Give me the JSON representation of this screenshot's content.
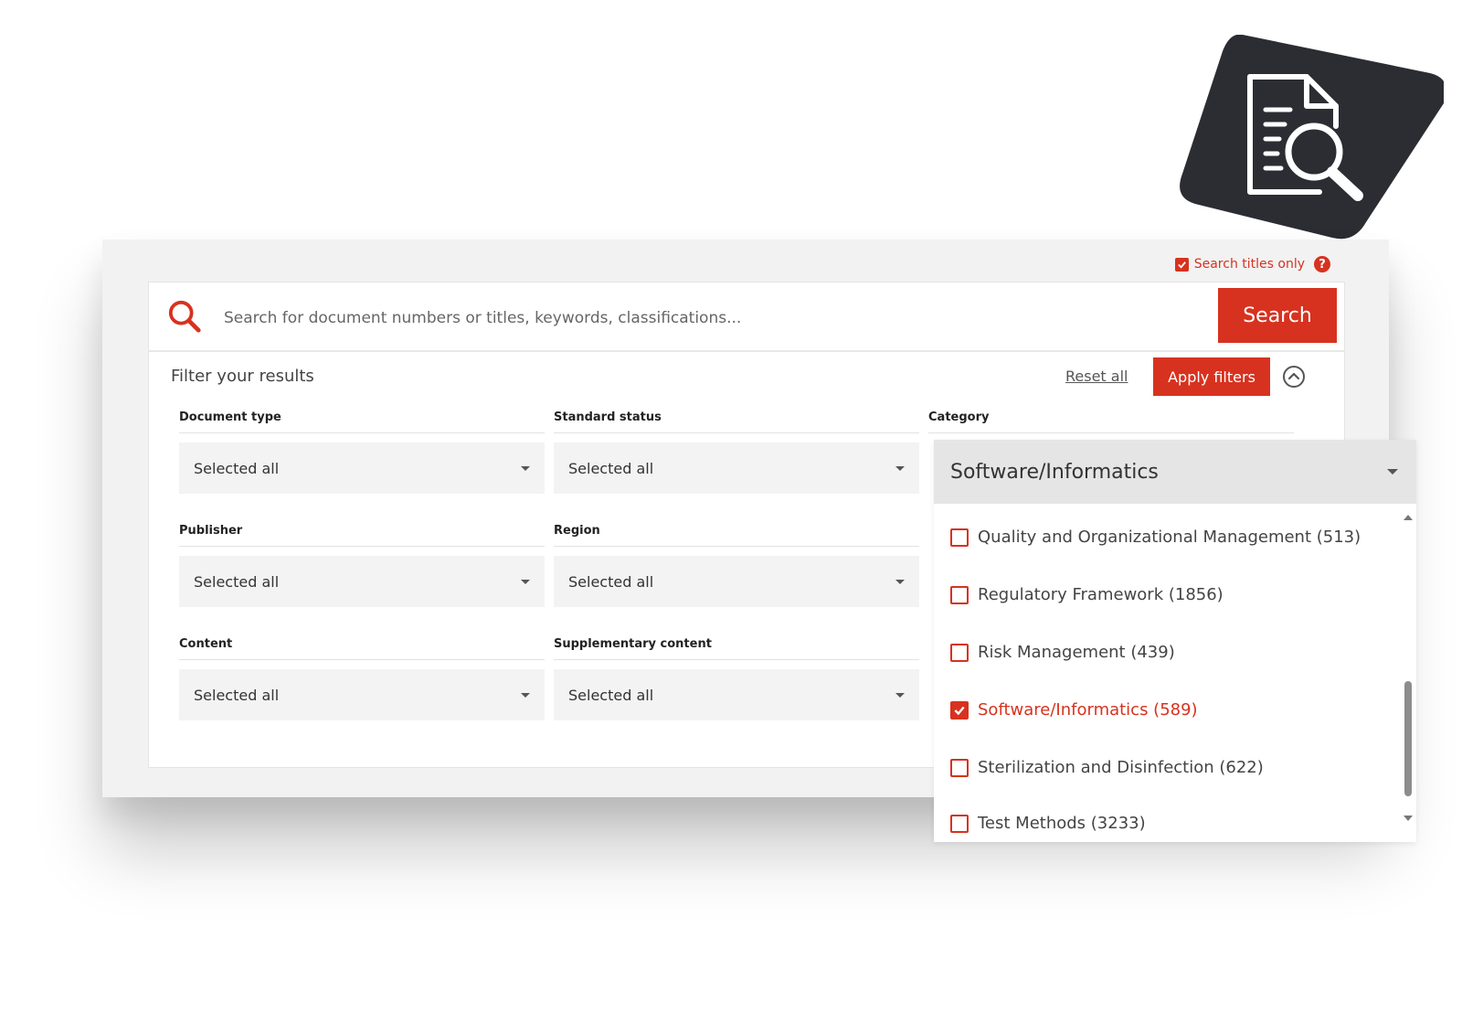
{
  "header_badge": {
    "icon": "document-search-icon"
  },
  "options": {
    "titles_only_label": "Search titles only",
    "titles_only_checked": true,
    "help_glyph": "?"
  },
  "search": {
    "placeholder": "Search for document numbers or titles, keywords, classifications...",
    "button_label": "Search"
  },
  "filters": {
    "title": "Filter your results",
    "reset_label": "Reset all",
    "apply_label": "Apply filters",
    "fields": [
      {
        "label": "Document type",
        "value": "Selected all"
      },
      {
        "label": "Standard status",
        "value": "Selected all"
      },
      {
        "label": "Category",
        "value": "Software/Informatics"
      },
      {
        "label": "Publisher",
        "value": "Selected all"
      },
      {
        "label": "Region",
        "value": "Selected all"
      },
      {
        "label": "Content",
        "value": "Selected all"
      },
      {
        "label": "Supplementary content",
        "value": "Selected all"
      }
    ]
  },
  "category_dropdown": {
    "selected": "Software/Informatics",
    "options": [
      {
        "label": "Quality and Organizational Management (513)",
        "checked": false
      },
      {
        "label": "Regulatory Framework (1856)",
        "checked": false
      },
      {
        "label": "Risk Management (439)",
        "checked": false
      },
      {
        "label": "Software/Informatics (589)",
        "checked": true
      },
      {
        "label": "Sterilization and Disinfection (622)",
        "checked": false
      },
      {
        "label": "Test Methods (3233)",
        "checked": false
      }
    ]
  },
  "colors": {
    "accent": "#d7321f",
    "dark_badge": "#2b2d33",
    "card_bg": "#f2f2f2"
  }
}
